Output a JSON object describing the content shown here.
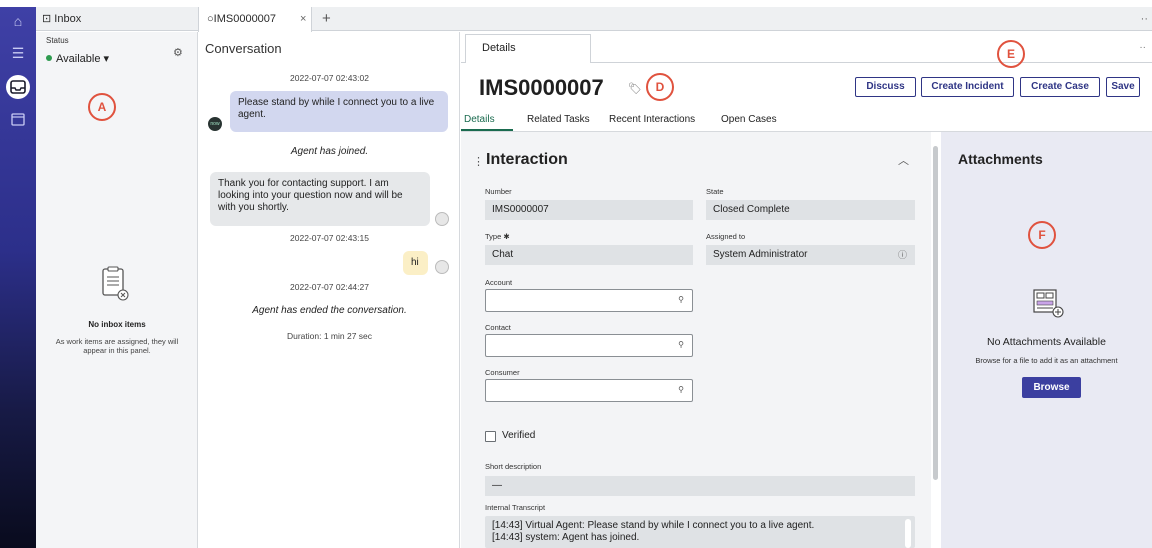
{
  "rail": {
    "icons": [
      "home-icon",
      "list-icon",
      "inbox-icon",
      "calendar-icon"
    ]
  },
  "top_tabs": {
    "inbox_label": "Inbox",
    "record_tab_label": "IMS0000007",
    "close_glyph": "×",
    "add_glyph": "+",
    "more_glyph": "··"
  },
  "inbox": {
    "status_label": "Status",
    "status_value": "Available",
    "empty_title": "No inbox items",
    "empty_text": "As work items are assigned, they will appear in this panel."
  },
  "conversation": {
    "title": "Conversation",
    "ts1": "2022-07-07 02:43:02",
    "bot_message": "Please stand by while I connect you to a live agent.",
    "bot_avatar": "now",
    "agent_joined": "Agent has joined.",
    "agent_message": "Thank you for contacting support. I am looking into your question now and will be with you shortly.",
    "ts2": "2022-07-07 02:43:15",
    "user_message": "hi",
    "ts3": "2022-07-07 02:44:27",
    "agent_ended": "Agent has ended the conversation.",
    "duration": "Duration: 1 min 27 sec"
  },
  "details": {
    "tab_label": "Details",
    "more_glyph": "··",
    "record_id": "IMS0000007",
    "buttons": {
      "discuss": "Discuss",
      "create_incident": "Create Incident",
      "create_case": "Create Case",
      "save": "Save"
    },
    "subtabs": {
      "details": "Details",
      "related": "Related Tasks",
      "recent": "Recent Interactions",
      "open": "Open Cases"
    },
    "section_title": "Interaction",
    "fields": {
      "number_label": "Number",
      "number_value": "IMS0000007",
      "state_label": "State",
      "state_value": "Closed Complete",
      "type_label": "Type ✱",
      "type_value": "Chat",
      "assigned_label": "Assigned to",
      "assigned_value": "System Administrator",
      "account_label": "Account",
      "contact_label": "Contact",
      "consumer_label": "Consumer",
      "verified_label": "Verified",
      "short_desc_label": "Short description",
      "short_desc_value": "—",
      "transcript_label": "Internal Transcript",
      "transcript_line1": "[14:43] Virtual Agent: Please stand by while I connect you to a live agent.",
      "transcript_line2": "[14:43] system: Agent has joined."
    }
  },
  "attachments": {
    "title": "Attachments",
    "empty_title": "No Attachments Available",
    "empty_text": "Browse for a file to add it as an attachment",
    "browse": "Browse"
  },
  "markers": {
    "a": "A",
    "d": "D",
    "e": "E",
    "f": "F"
  },
  "colors": {
    "accent": "#2f3585",
    "marker": "#e0523e",
    "available": "#2e9b4f",
    "active_tab": "#1a6b4f"
  }
}
